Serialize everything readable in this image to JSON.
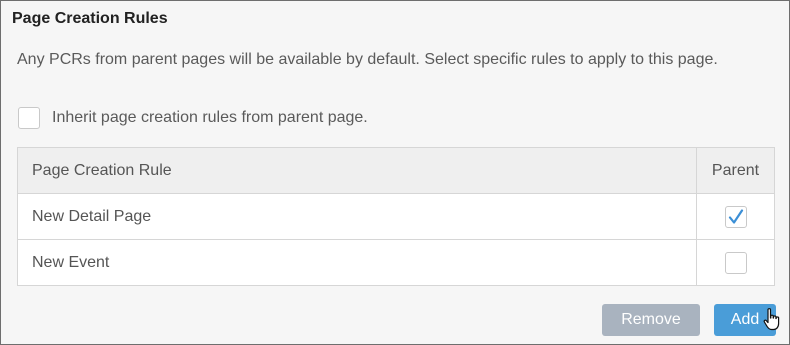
{
  "panel": {
    "title": "Page Creation Rules",
    "description": "Any PCRs from parent pages will be available by default. Select specific rules to apply to this page."
  },
  "inherit": {
    "label": "Inherit page creation rules from parent page.",
    "checked": false
  },
  "table": {
    "headers": {
      "rule": "Page Creation Rule",
      "parent": "Parent"
    },
    "rows": [
      {
        "rule": "New Detail Page",
        "parent_checked": true
      },
      {
        "rule": "New Event",
        "parent_checked": false
      }
    ]
  },
  "buttons": {
    "remove_label": "Remove",
    "add_label": "Add"
  },
  "colors": {
    "add_button": "#4a9dd8",
    "remove_button": "#a9b3bf",
    "check_mark": "#3b8fd6"
  },
  "icons": {
    "cursor": "hand-pointer-icon",
    "check": "checkmark-icon"
  }
}
